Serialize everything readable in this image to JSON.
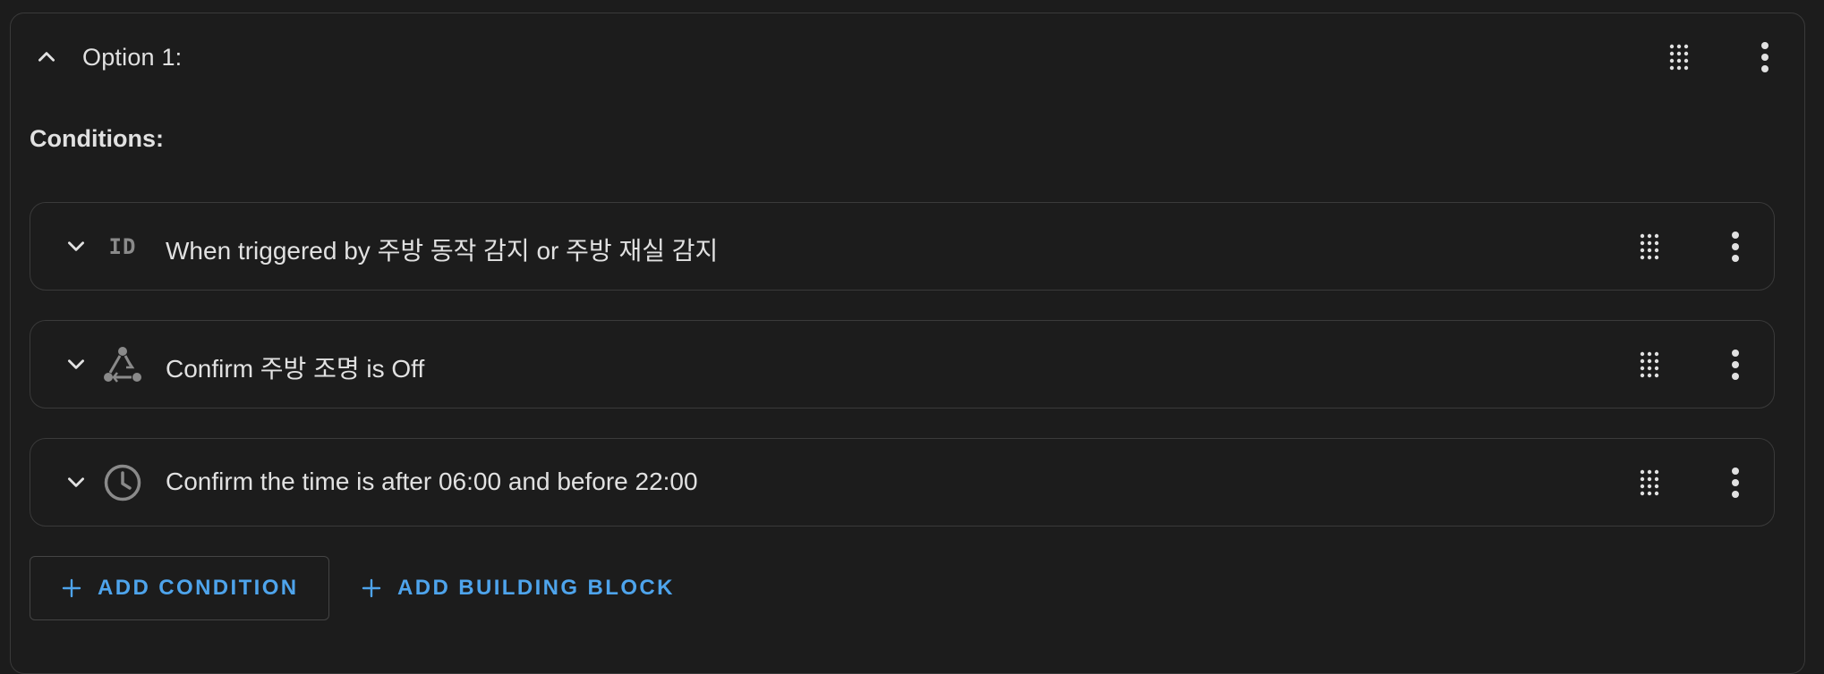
{
  "option": {
    "title": "Option 1:",
    "collapse_icon": "chevron-up-icon",
    "handle_icon": "drag-handle-icon",
    "menu_icon": "more-vertical-icon"
  },
  "conditions": {
    "label": "Conditions:",
    "items": [
      {
        "icon": "id-icon",
        "icon_text": "ID",
        "label": "When triggered by 주방 동작 감지 or 주방 재실 감지"
      },
      {
        "icon": "device-state-icon",
        "label": "Confirm 주방 조명 is Off"
      },
      {
        "icon": "clock-icon",
        "label": "Confirm the time is after 06:00 and before 22:00"
      }
    ]
  },
  "actions": {
    "add_condition": "ADD CONDITION",
    "add_building_block": "ADD BUILDING BLOCK"
  },
  "colors": {
    "background": "#1c1c1c",
    "border": "#3a3a3a",
    "text": "#e1e1e1",
    "icon": "#8a8a8a",
    "accent": "#4ea4ec"
  }
}
